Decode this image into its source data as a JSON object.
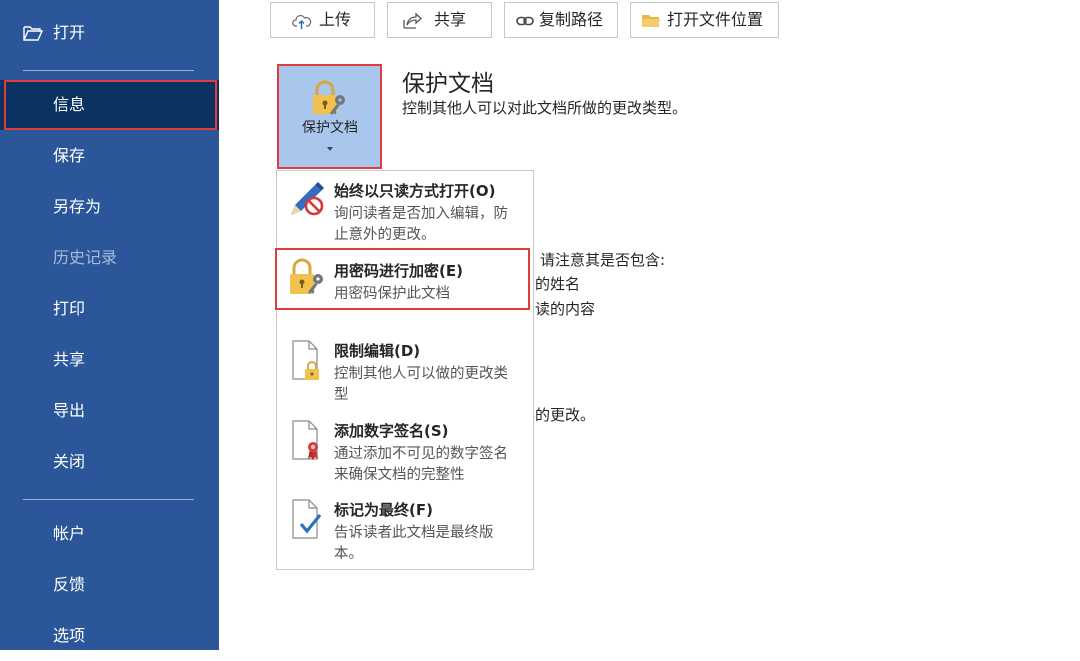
{
  "sidebar": {
    "open_label": "打开",
    "items": [
      {
        "label": "信息"
      },
      {
        "label": "保存"
      },
      {
        "label": "另存为"
      },
      {
        "label": "历史记录"
      },
      {
        "label": "打印"
      },
      {
        "label": "共享"
      },
      {
        "label": "导出"
      },
      {
        "label": "关闭"
      },
      {
        "label": "帐户"
      },
      {
        "label": "反馈"
      },
      {
        "label": "选项"
      }
    ],
    "active_item": "信息",
    "accent_color": "#2b579a"
  },
  "toolbar": {
    "upload_label": "上传",
    "share_label": "共享",
    "copy_path_label": "复制路径",
    "open_location_label": "打开文件位置"
  },
  "protect": {
    "button_label": "保护文档",
    "title": "保护文档",
    "description": "控制其他人可以对此文档所做的更改类型。"
  },
  "background_text": {
    "line1": "请注意其是否包含:",
    "line2": "者的姓名",
    "line3": "阅读的内容",
    "line4": "存的更改。"
  },
  "menu": {
    "items": [
      {
        "title": "始终以只读方式打开(O)",
        "desc": "询问读者是否加入编辑，防止意外的更改。",
        "icon": "pencil-no-icon"
      },
      {
        "title": "用密码进行加密(E)",
        "desc": "用密码保护此文档",
        "icon": "lock-key-icon"
      },
      {
        "title": "限制编辑(D)",
        "desc": "控制其他人可以做的更改类型",
        "icon": "document-lock-icon"
      },
      {
        "title": "添加数字签名(S)",
        "desc": "通过添加不可见的数字签名来确保文档的完整性",
        "icon": "document-ribbon-icon"
      },
      {
        "title": "标记为最终(F)",
        "desc": "告诉读者此文档是最终版本。",
        "icon": "document-check-icon"
      }
    ]
  }
}
